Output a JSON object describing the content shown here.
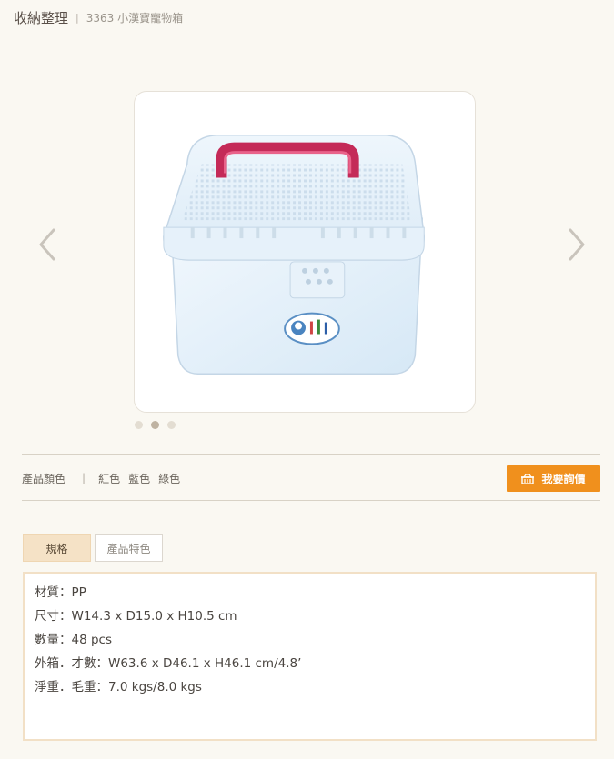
{
  "breadcrumb": {
    "category": "收納整理",
    "separator": "|",
    "product": "3363 小漢寶寵物箱"
  },
  "carousel": {
    "prev_icon": "chevron-left-icon",
    "next_icon": "chevron-right-icon",
    "image_alt": "3363 小漢寶寵物箱",
    "slide_count": 3,
    "active_slide": 2
  },
  "colors": {
    "label": "產品顏色",
    "separator": "|",
    "options": [
      "紅色",
      "藍色",
      "綠色"
    ]
  },
  "inquiry": {
    "label": "我要詢價",
    "icon": "basket-icon",
    "color": "#f0901d"
  },
  "tabs": [
    {
      "label": "規格",
      "active": true
    },
    {
      "label": "產品特色",
      "active": false
    }
  ],
  "specs": [
    "材質：PP",
    "尺寸：W14.3 x D15.0 x H10.5 cm",
    "數量：48 pcs",
    "外箱．才數：W63.6 x D46.1 x H46.1 cm/4.8’",
    "淨重．毛重：7.0 kgs/8.0 kgs"
  ]
}
